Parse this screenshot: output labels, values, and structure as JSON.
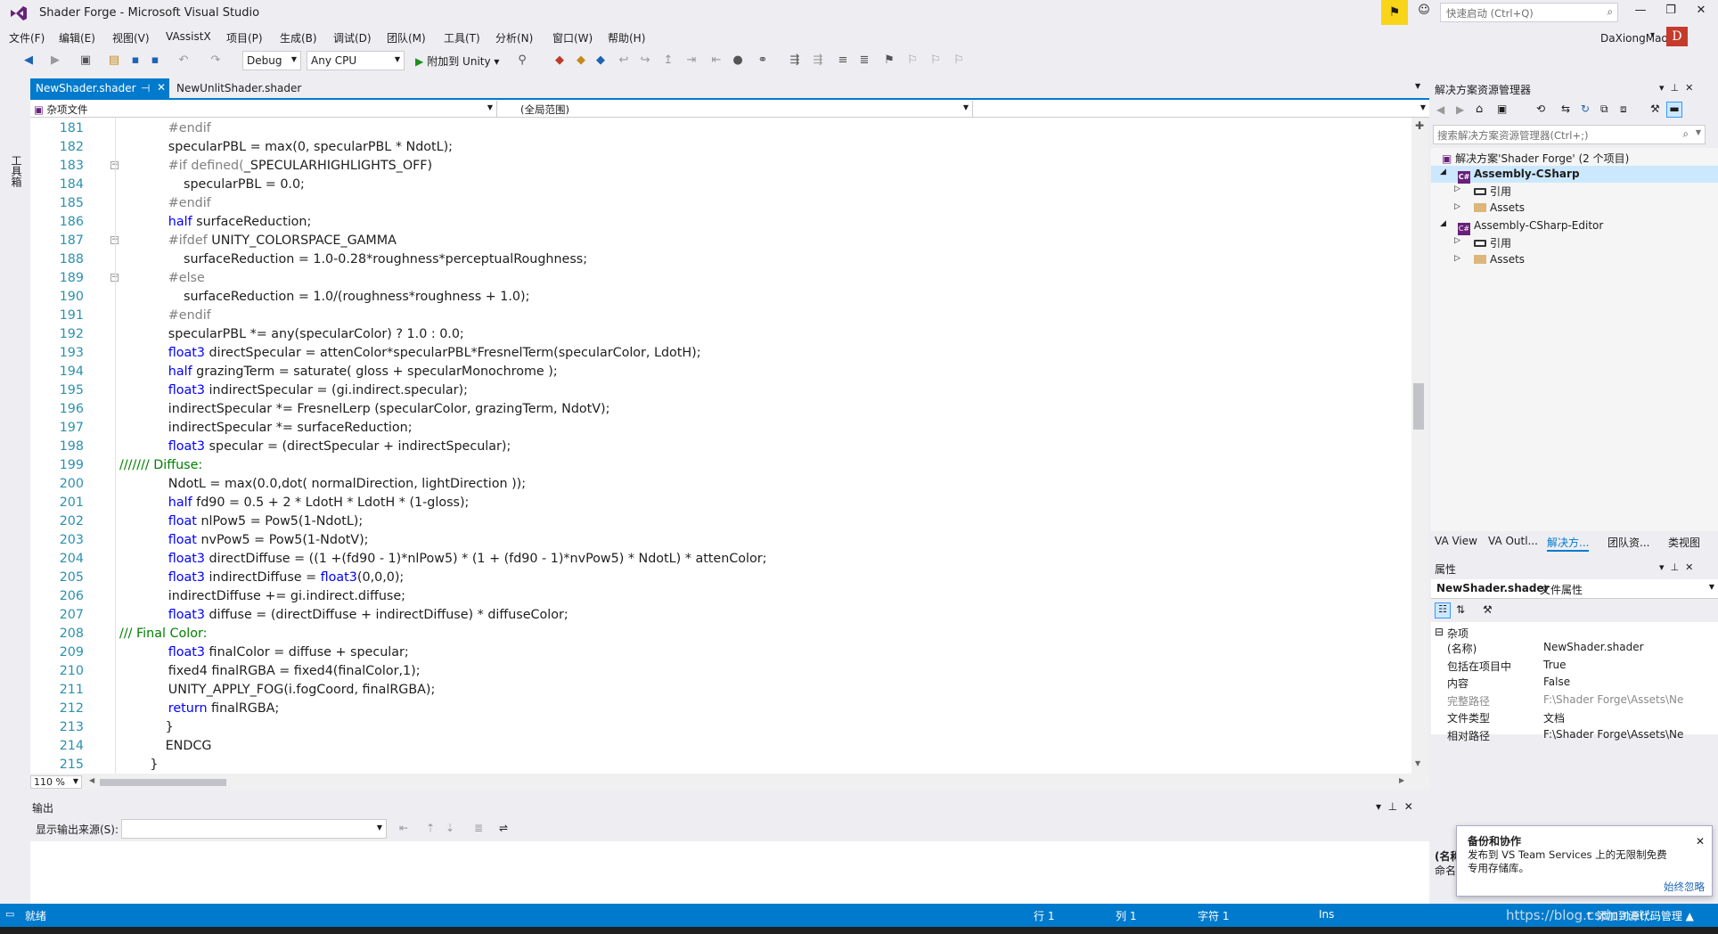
{
  "window": {
    "title": "Shader Forge - Microsoft Visual Studio",
    "controls": [
      "—",
      "❐",
      "✕"
    ]
  },
  "quick_launch": {
    "placeholder": "快速启动 (Ctrl+Q)"
  },
  "menu": [
    "文件(F)",
    "编辑(E)",
    "视图(V)",
    "VAssistX",
    "项目(P)",
    "生成(B)",
    "调试(D)",
    "团队(M)",
    "工具(T)",
    "分析(N)",
    "窗口(W)",
    "帮助(H)"
  ],
  "user": {
    "name": "DaXiongMao",
    "initial": "D"
  },
  "toolbar": {
    "config": "Debug",
    "platform": "Any CPU",
    "attach": "附加到 Unity"
  },
  "left_tab": "工具箱",
  "tabs": [
    {
      "label": "NewShader.shader",
      "active": true
    },
    {
      "label": "NewUnlitShader.shader",
      "active": false
    }
  ],
  "nav": {
    "project": "杂项文件",
    "scope": "(全局范围)"
  },
  "code_lines": [
    {
      "n": "181",
      "i": 4,
      "t": [
        [
          "#endif",
          "pp"
        ]
      ]
    },
    {
      "n": "182",
      "i": 4,
      "t": [
        [
          "specularPBL = max(0, specularPBL * NdotL);",
          ""
        ]
      ]
    },
    {
      "n": "183",
      "i": 4,
      "f": true,
      "t": [
        [
          "#if defined(",
          "pp"
        ],
        [
          "_SPECULARHIGHLIGHTS_OFF",
          ""
        ],
        [
          ")",
          ""
        ]
      ]
    },
    {
      "n": "184",
      "i": 5,
      "t": [
        [
          "specularPBL = 0.0;",
          ""
        ]
      ]
    },
    {
      "n": "185",
      "i": 4,
      "t": [
        [
          "#endif",
          "pp"
        ]
      ]
    },
    {
      "n": "186",
      "i": 4,
      "t": [
        [
          "half",
          "kw"
        ],
        [
          " surfaceReduction;",
          ""
        ]
      ]
    },
    {
      "n": "187",
      "i": 4,
      "f": true,
      "t": [
        [
          "#ifdef ",
          "pp"
        ],
        [
          "UNITY_COLORSPACE_GAMMA",
          ""
        ]
      ]
    },
    {
      "n": "188",
      "i": 5,
      "t": [
        [
          "surfaceReduction = 1.0-0.28*roughness*perceptualRoughness;",
          ""
        ]
      ]
    },
    {
      "n": "189",
      "i": 4,
      "f": true,
      "t": [
        [
          "#else",
          "pp"
        ]
      ]
    },
    {
      "n": "190",
      "i": 5,
      "t": [
        [
          "surfaceReduction = 1.0/(roughness*roughness + 1.0);",
          ""
        ]
      ]
    },
    {
      "n": "191",
      "i": 4,
      "t": [
        [
          "#endif",
          "pp"
        ]
      ]
    },
    {
      "n": "192",
      "i": 4,
      "t": [
        [
          "specularPBL *= any(specularColor) ? 1.0 : 0.0;",
          ""
        ]
      ]
    },
    {
      "n": "193",
      "i": 4,
      "t": [
        [
          "float3",
          "kw"
        ],
        [
          " directSpecular = attenColor*specularPBL*FresnelTerm(specularColor, LdotH);",
          ""
        ]
      ]
    },
    {
      "n": "194",
      "i": 4,
      "t": [
        [
          "half",
          "kw"
        ],
        [
          " grazingTerm = saturate( gloss + specularMonochrome );",
          ""
        ]
      ]
    },
    {
      "n": "195",
      "i": 4,
      "t": [
        [
          "float3",
          "kw"
        ],
        [
          " indirectSpecular = (gi.indirect.specular);",
          ""
        ]
      ]
    },
    {
      "n": "196",
      "i": 4,
      "t": [
        [
          "indirectSpecular *= FresnelLerp (specularColor, grazingTerm, NdotV);",
          ""
        ]
      ]
    },
    {
      "n": "197",
      "i": 4,
      "t": [
        [
          "indirectSpecular *= surfaceReduction;",
          ""
        ]
      ]
    },
    {
      "n": "198",
      "i": 4,
      "t": [
        [
          "float3",
          "kw"
        ],
        [
          " specular = (directSpecular + indirectSpecular);",
          ""
        ]
      ]
    },
    {
      "n": "199",
      "i": 0,
      "t": [
        [
          "/////// Diffuse:",
          "cm"
        ]
      ]
    },
    {
      "n": "200",
      "i": 4,
      "t": [
        [
          "NdotL = max(0.0,dot( normalDirection, lightDirection ));",
          ""
        ]
      ]
    },
    {
      "n": "201",
      "i": 4,
      "t": [
        [
          "half",
          "kw"
        ],
        [
          " fd90 = 0.5 + 2 * LdotH * LdotH * (1-gloss);",
          ""
        ]
      ]
    },
    {
      "n": "202",
      "i": 4,
      "t": [
        [
          "float",
          "kw"
        ],
        [
          " nlPow5 = Pow5(1-NdotL);",
          ""
        ]
      ]
    },
    {
      "n": "203",
      "i": 4,
      "t": [
        [
          "float",
          "kw"
        ],
        [
          " nvPow5 = Pow5(1-NdotV);",
          ""
        ]
      ]
    },
    {
      "n": "204",
      "i": 4,
      "t": [
        [
          "float3",
          "kw"
        ],
        [
          " directDiffuse = ((1 +(fd90 - 1)*nlPow5) * (1 + (fd90 - 1)*nvPow5) * NdotL) * attenColor;",
          ""
        ]
      ]
    },
    {
      "n": "205",
      "i": 4,
      "t": [
        [
          "float3",
          "kw"
        ],
        [
          " indirectDiffuse = ",
          ""
        ],
        [
          "float3",
          "kw"
        ],
        [
          "(0,0,0);",
          ""
        ]
      ]
    },
    {
      "n": "206",
      "i": 4,
      "t": [
        [
          "indirectDiffuse += gi.indirect.diffuse;",
          ""
        ]
      ]
    },
    {
      "n": "207",
      "i": 4,
      "t": [
        [
          "float3",
          "kw"
        ],
        [
          " diffuse = (directDiffuse + indirectDiffuse) * diffuseColor;",
          ""
        ]
      ]
    },
    {
      "n": "208",
      "i": 0,
      "t": [
        [
          "/// Final Color:",
          "cm"
        ]
      ]
    },
    {
      "n": "209",
      "i": 4,
      "t": [
        [
          "float3",
          "kw"
        ],
        [
          " finalColor = diffuse + specular;",
          ""
        ]
      ]
    },
    {
      "n": "210",
      "i": 4,
      "t": [
        [
          "fixed4 finalRGBA = fixed4(finalColor,1);",
          ""
        ]
      ]
    },
    {
      "n": "211",
      "i": 4,
      "t": [
        [
          "UNITY_APPLY_FOG(i.fogCoord, finalRGBA);",
          ""
        ]
      ]
    },
    {
      "n": "212",
      "i": 4,
      "t": [
        [
          "return",
          "kw"
        ],
        [
          " finalRGBA;",
          ""
        ]
      ]
    },
    {
      "n": "213",
      "i": 3,
      "t": [
        [
          "}",
          ""
        ]
      ]
    },
    {
      "n": "214",
      "i": 3,
      "t": [
        [
          "ENDCG",
          ""
        ]
      ]
    },
    {
      "n": "215",
      "i": 2,
      "t": [
        [
          "}",
          ""
        ]
      ]
    }
  ],
  "zoom": "110 %",
  "output": {
    "title": "输出",
    "source_label": "显示输出来源(S):",
    "source_value": ""
  },
  "solution_explorer": {
    "title": "解决方案资源管理器",
    "search_placeholder": "搜索解决方案资源管理器(Ctrl+;)",
    "solution": "解决方案'Shader Forge' (2 个项目)",
    "project1": "Assembly-CSharp",
    "project2": "Assembly-CSharp-Editor",
    "refs": "引用",
    "assets": "Assets"
  },
  "panel_tabs": [
    "VA View",
    "VA Outl...",
    "解决方...",
    "团队资...",
    "类视图"
  ],
  "properties": {
    "title": "属性",
    "object": "NewShader.shader",
    "object_type": "文件属性",
    "category": "杂项",
    "rows": [
      {
        "k": "(名称)",
        "v": "NewShader.shader",
        "dim": false
      },
      {
        "k": "包括在项目中",
        "v": "True",
        "dim": false
      },
      {
        "k": "内容",
        "v": "False",
        "dim": false
      },
      {
        "k": "完整路径",
        "v": "F:\\Shader Forge\\Assets\\Ne",
        "dim": true
      },
      {
        "k": "文件类型",
        "v": "文档",
        "dim": false
      },
      {
        "k": "相对路径",
        "v": "F:\\Shader Forge\\Assets\\Ne",
        "dim": false
      }
    ],
    "desc_title": "(名称",
    "desc_text": "命名"
  },
  "toast": {
    "title": "备份和协作",
    "body1": "发布到 VS Team Services 上的无限制免费",
    "body2": "专用存储库。",
    "link": "始终忽略"
  },
  "status": {
    "ready": "就绪",
    "line": "行 1",
    "col": "列 1",
    "char": "字符 1",
    "mode": "Ins",
    "publish": "↑ 添加到源代码管理 ▲"
  },
  "watermark": "https://blog.csdn.net/...",
  "colors": {
    "accent": "#007acc",
    "keyword": "#0000ff",
    "comment": "#008000",
    "preproc": "#808080",
    "line_number": "#2b91af"
  }
}
